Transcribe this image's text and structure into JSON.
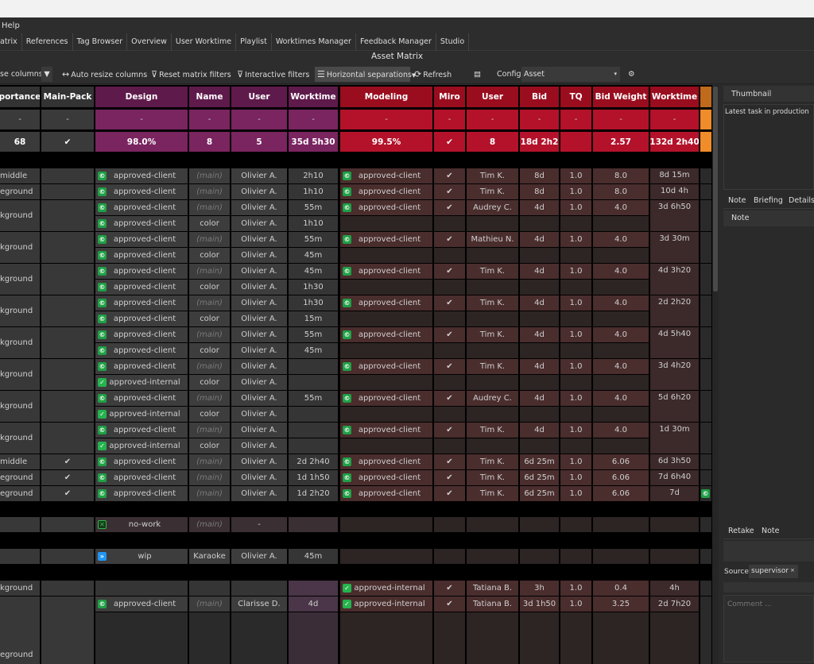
{
  "menu": {
    "help": "Help"
  },
  "tabs": [
    "atrix",
    "References",
    "Tag Browser",
    "Overview",
    "User Worktime",
    "Playlist",
    "Worktimes Manager",
    "Feedback Manager",
    "Studio"
  ],
  "title": "Asset Matrix",
  "toolbar": {
    "collapse": "se columns",
    "auto_resize": "Auto resize columns",
    "reset_filters": "Reset matrix filters",
    "interactive": "Interactive filters",
    "horizontal": "Horizontal separations",
    "refresh": "Refresh",
    "config_label": "Config:",
    "config_value": "Asset"
  },
  "headers": {
    "importance": "portance",
    "main_pack": "Main-Pack",
    "design": "Design",
    "name": "Name",
    "user": "User",
    "worktime": "Worktime",
    "modeling": "Modeling",
    "miro": "Miro",
    "muser": "User",
    "bid": "Bid",
    "tq": "TQ",
    "bid_weight": "Bid Weight",
    "mworktime": "Worktime"
  },
  "filter_row": "-",
  "summary": {
    "importance": "68",
    "main_pack": "✔",
    "design": "98.0%",
    "name": "8",
    "user": "5",
    "worktime": "35d 5h30",
    "modeling": "99.5%",
    "miro": "✔",
    "muser": "8",
    "bid": "118d 2h20",
    "tq": "",
    "bid_weight": "2.57",
    "mworktime": "132d 2h40"
  },
  "rows": [
    {
      "imp": "middle",
      "mp": "",
      "d": [
        {
          "s": "approved-client",
          "n": "(main)",
          "u": "Olivier A.",
          "w": "2h10"
        }
      ],
      "m": {
        "s": "approved-client",
        "miro": "✔",
        "u": "Tim K.",
        "bid": "8d",
        "tq": "1.0",
        "bw": "8.0",
        "w": "8d 15m"
      }
    },
    {
      "imp": "eground",
      "mp": "",
      "d": [
        {
          "s": "approved-client",
          "n": "(main)",
          "u": "Olivier A.",
          "w": "1h10"
        }
      ],
      "m": {
        "s": "approved-client",
        "miro": "✔",
        "u": "Tim K.",
        "bid": "8d",
        "tq": "1.0",
        "bw": "8.0",
        "w": "10d 4h"
      }
    },
    {
      "imp": "kground",
      "mp": "",
      "d": [
        {
          "s": "approved-client",
          "n": "(main)",
          "u": "Olivier A.",
          "w": "55m"
        },
        {
          "s": "approved-client",
          "n": "color",
          "u": "Olivier A.",
          "w": "1h10"
        }
      ],
      "m": {
        "s": "approved-client",
        "miro": "✔",
        "u": "Audrey C.",
        "bid": "4d",
        "tq": "1.0",
        "bw": "4.0",
        "w": "3d 6h50"
      }
    },
    {
      "imp": "kground",
      "mp": "",
      "d": [
        {
          "s": "approved-client",
          "n": "(main)",
          "u": "Olivier A.",
          "w": "55m"
        },
        {
          "s": "approved-client",
          "n": "color",
          "u": "Olivier A.",
          "w": "45m"
        }
      ],
      "m": {
        "s": "approved-client",
        "miro": "✔",
        "u": "Mathieu N.",
        "bid": "4d",
        "tq": "1.0",
        "bw": "4.0",
        "w": "3d 30m"
      }
    },
    {
      "imp": "kground",
      "mp": "",
      "d": [
        {
          "s": "approved-client",
          "n": "(main)",
          "u": "Olivier A.",
          "w": "45m"
        },
        {
          "s": "approved-client",
          "n": "color",
          "u": "Olivier A.",
          "w": "1h30"
        }
      ],
      "m": {
        "s": "approved-client",
        "miro": "✔",
        "u": "Tim K.",
        "bid": "4d",
        "tq": "1.0",
        "bw": "4.0",
        "w": "4d 3h20"
      }
    },
    {
      "imp": "kground",
      "mp": "",
      "d": [
        {
          "s": "approved-client",
          "n": "(main)",
          "u": "Olivier A.",
          "w": "1h30"
        },
        {
          "s": "approved-client",
          "n": "color",
          "u": "Olivier A.",
          "w": "15m"
        }
      ],
      "m": {
        "s": "approved-client",
        "miro": "✔",
        "u": "Tim K.",
        "bid": "4d",
        "tq": "1.0",
        "bw": "4.0",
        "w": "2d 2h20"
      }
    },
    {
      "imp": "kground",
      "mp": "",
      "d": [
        {
          "s": "approved-client",
          "n": "(main)",
          "u": "Olivier A.",
          "w": "55m"
        },
        {
          "s": "approved-client",
          "n": "color",
          "u": "Olivier A.",
          "w": "45m"
        }
      ],
      "m": {
        "s": "approved-client",
        "miro": "✔",
        "u": "Tim K.",
        "bid": "4d",
        "tq": "1.0",
        "bw": "4.0",
        "w": "4d 5h40"
      }
    },
    {
      "imp": "kground",
      "mp": "",
      "d": [
        {
          "s": "approved-client",
          "n": "(main)",
          "u": "Olivier A.",
          "w": ""
        },
        {
          "s": "approved-internal",
          "n": "color",
          "u": "Olivier A.",
          "w": ""
        }
      ],
      "m": {
        "s": "approved-client",
        "miro": "✔",
        "u": "Tim K.",
        "bid": "4d",
        "tq": "1.0",
        "bw": "4.0",
        "w": "3d 4h20"
      }
    },
    {
      "imp": "kground",
      "mp": "",
      "d": [
        {
          "s": "approved-client",
          "n": "(main)",
          "u": "Olivier A.",
          "w": "55m"
        },
        {
          "s": "approved-internal",
          "n": "color",
          "u": "Olivier A.",
          "w": ""
        }
      ],
      "m": {
        "s": "approved-client",
        "miro": "✔",
        "u": "Audrey C.",
        "bid": "4d",
        "tq": "1.0",
        "bw": "4.0",
        "w": "5d 6h20"
      }
    },
    {
      "imp": "kground",
      "mp": "",
      "d": [
        {
          "s": "approved-client",
          "n": "(main)",
          "u": "Olivier A.",
          "w": ""
        },
        {
          "s": "approved-internal",
          "n": "color",
          "u": "Olivier A.",
          "w": ""
        }
      ],
      "m": {
        "s": "approved-client",
        "miro": "✔",
        "u": "Tim K.",
        "bid": "4d",
        "tq": "1.0",
        "bw": "4.0",
        "w": "1d 30m"
      }
    },
    {
      "imp": "middle",
      "mp": "✔",
      "d": [
        {
          "s": "approved-client",
          "n": "(main)",
          "u": "Olivier A.",
          "w": "2d 2h40"
        }
      ],
      "m": {
        "s": "approved-client",
        "miro": "✔",
        "u": "Tim K.",
        "bid": "6d 25m",
        "tq": "1.0",
        "bw": "6.06",
        "w": "6d 3h50"
      }
    },
    {
      "imp": "eground",
      "mp": "✔",
      "d": [
        {
          "s": "approved-client",
          "n": "(main)",
          "u": "Olivier A.",
          "w": "1d 1h50"
        }
      ],
      "m": {
        "s": "approved-client",
        "miro": "✔",
        "u": "Tim K.",
        "bid": "6d 25m",
        "tq": "1.0",
        "bw": "6.06",
        "w": "7d 6h40"
      }
    },
    {
      "imp": "eground",
      "mp": "✔",
      "d": [
        {
          "s": "approved-client",
          "n": "(main)",
          "u": "Olivier A.",
          "w": "1d 2h20"
        }
      ],
      "m": {
        "s": "approved-client",
        "miro": "✔",
        "u": "Tim K.",
        "bid": "6d 25m",
        "tq": "1.0",
        "bw": "6.06",
        "w": "7d"
      }
    }
  ],
  "nowork": {
    "s": "no-work",
    "n": "(main)",
    "u": "-"
  },
  "wip": {
    "s": "wip",
    "n": "Karaoke",
    "u": "Olivier A.",
    "w": "45m"
  },
  "last1": {
    "imp": "kground",
    "m": {
      "s": "approved-internal",
      "miro": "✔",
      "u": "Tatiana B.",
      "bid": "3h",
      "tq": "1.0",
      "bw": "0.4",
      "w": "4h"
    }
  },
  "last2": {
    "d": {
      "s": "approved-client",
      "n": "(main)",
      "u": "Clarisse D.",
      "w": "4d"
    },
    "m": {
      "s": "approved-internal",
      "miro": "✔",
      "u": "Tatiana B.",
      "bid": "3d 1h50",
      "tq": "1.0",
      "bw": "3.25",
      "w": "2d 7h20"
    }
  },
  "last_label": "eground",
  "right": {
    "thumbnail": "Thumbnail",
    "latest": "Latest task in production",
    "tab_note": "Note",
    "tab_briefing": "Briefing",
    "tab_details": "Details",
    "note_label": "Note",
    "retake": "Retake",
    "note2": "Note",
    "source_label": "Source",
    "source_value": "supervisor",
    "comment_placeholder": "Comment ..."
  },
  "colors": {
    "design": "#5f1a4c",
    "design_light": "#7a2460",
    "modeling": "#9a0d1e",
    "modeling_light": "#b3122a",
    "orange": "#f08c2a"
  }
}
